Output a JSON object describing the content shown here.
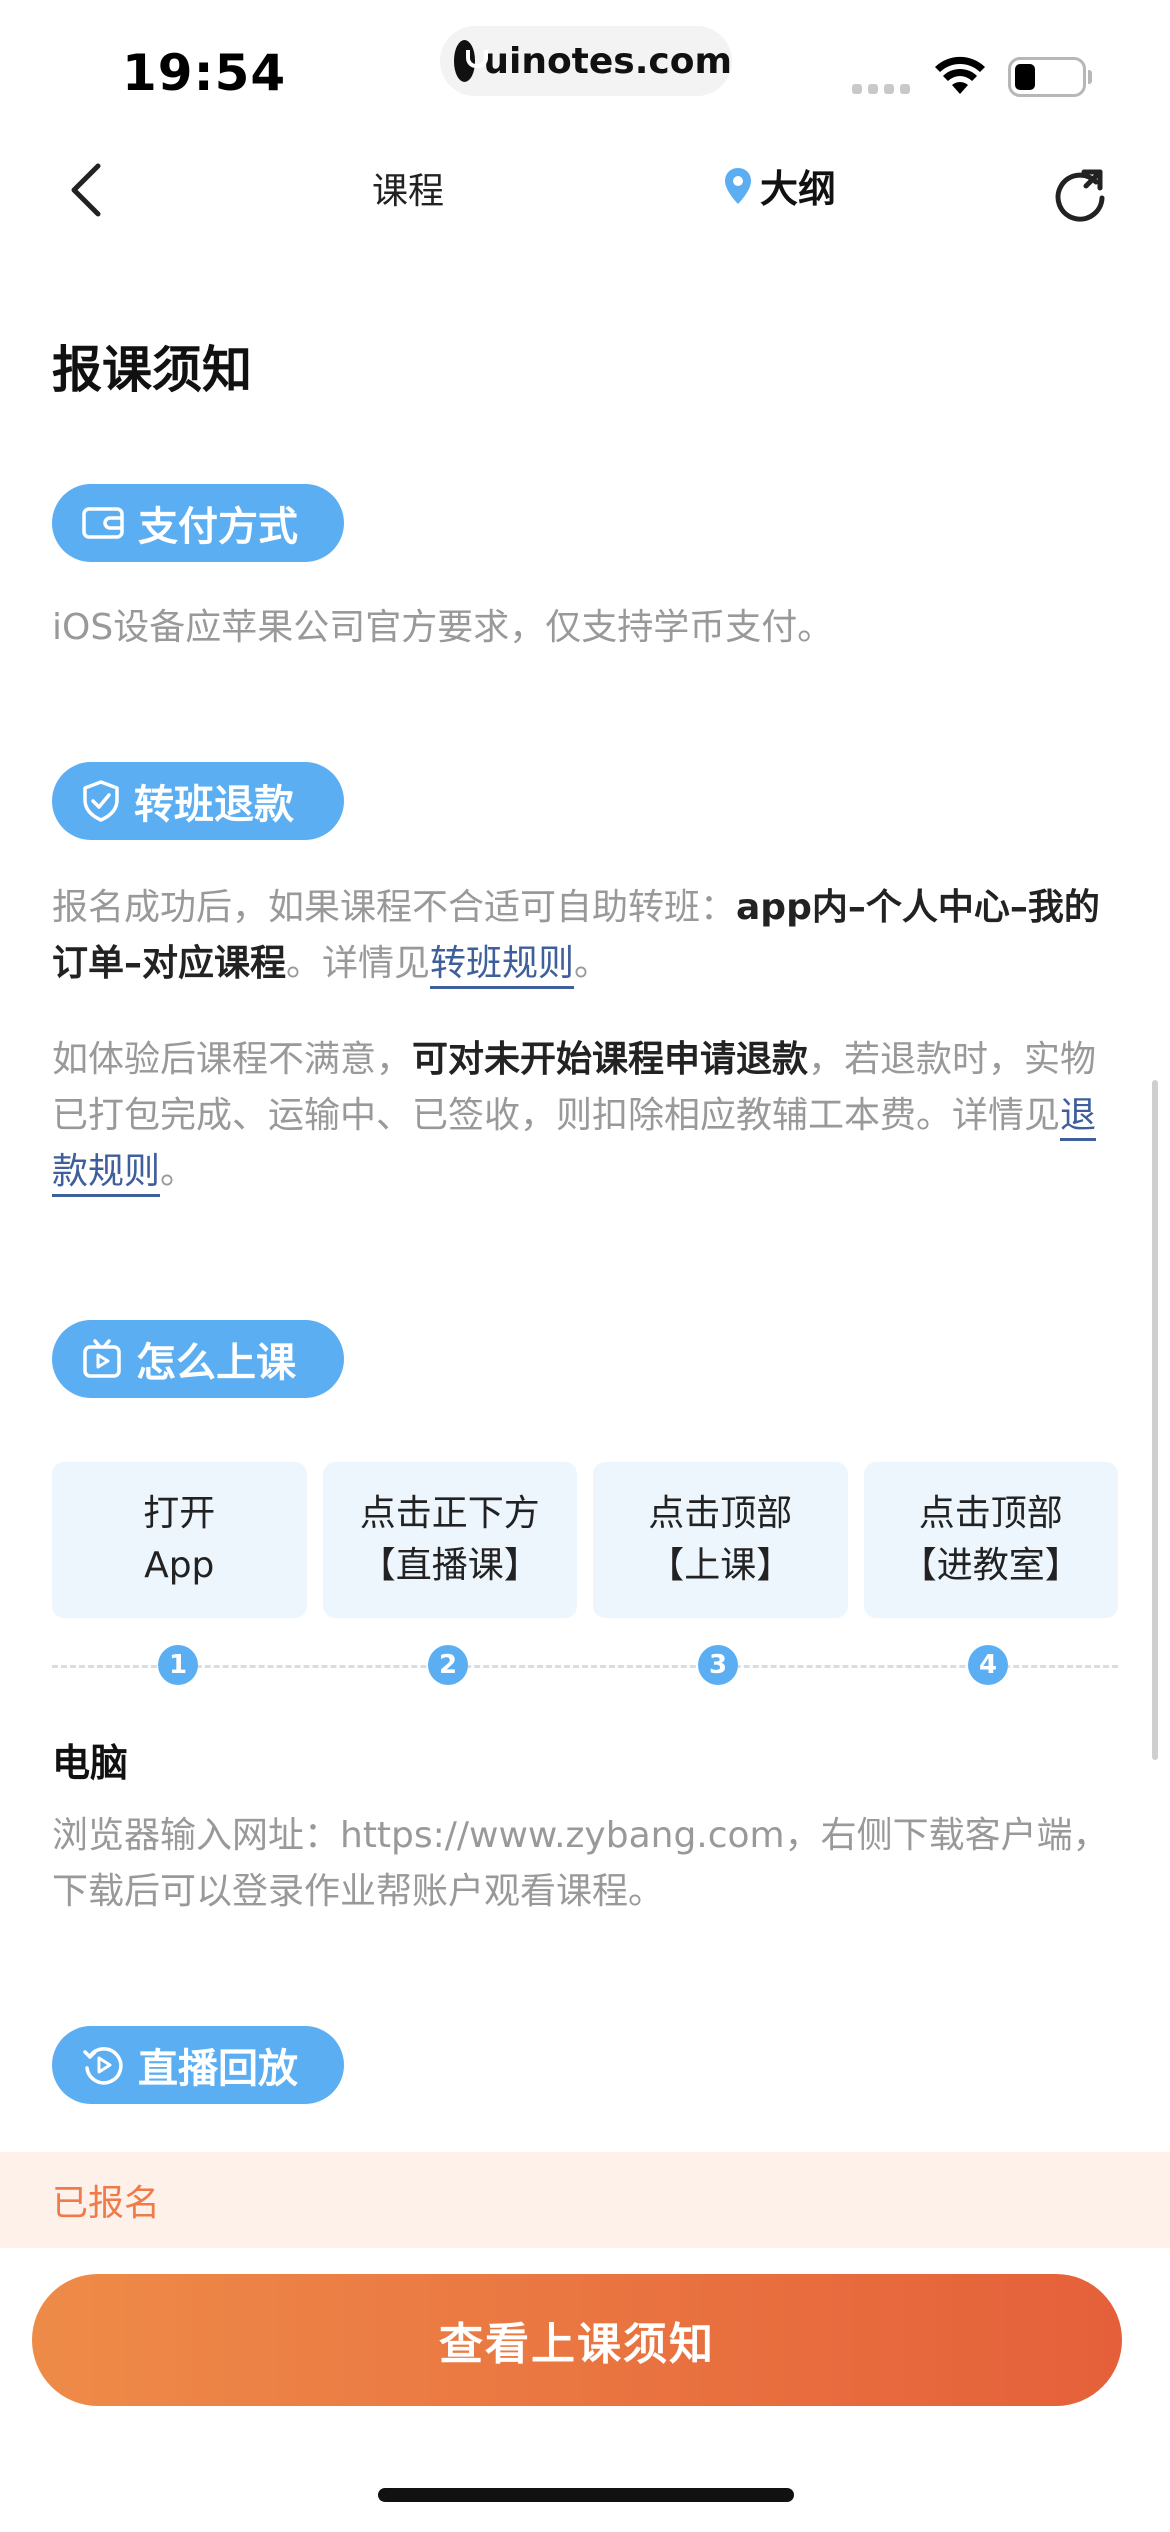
{
  "status_bar": {
    "time": "19:54",
    "url": "uinotes.com"
  },
  "nav": {
    "back_icon": "chevron-left-icon",
    "title": "课程",
    "outline_label": "大纲",
    "outline_icon": "location-pin-icon",
    "refresh_icon": "refresh-icon"
  },
  "page": {
    "heading": "报课须知",
    "payment": {
      "tag": "支付方式",
      "icon": "wallet-icon",
      "text": "iOS设备应苹果公司官方要求，仅支持学币支付。"
    },
    "transfer": {
      "tag": "转班退款",
      "icon": "shield-check-icon",
      "p1_a": "报名成功后，如果课程不合适可自助转班：",
      "p1_b": "app内–个人中心–我的订单–对应课程",
      "p1_c": "。详情见",
      "p1_link": "转班规则",
      "p1_end": "。",
      "p2_a": "如体验后课程不满意，",
      "p2_b": "可对未开始课程申请退款",
      "p2_c": "，若退款时，实物已打包完成、运输中、已签收，则扣除相应教辅工本费。详情见",
      "p2_link": "退款规则",
      "p2_end": "。"
    },
    "how": {
      "tag": "怎么上课",
      "icon": "tv-play-icon",
      "steps": [
        {
          "line1": "打开",
          "line2": "App",
          "num": "1"
        },
        {
          "line1": "点击正下方",
          "line2": "【直播课】",
          "num": "2"
        },
        {
          "line1": "点击顶部",
          "line2": "【上课】",
          "num": "3"
        },
        {
          "line1": "点击顶部",
          "line2": "【进教室】",
          "num": "4"
        }
      ],
      "pc_title": "电脑",
      "pc_text": "浏览器输入网址：https://www.zybang.com，右侧下载客户端，下载后可以登录作业帮账户观看课程。"
    },
    "replay": {
      "tag": "直播回放",
      "icon": "replay-icon"
    }
  },
  "bottom": {
    "enrolled": "已报名",
    "cta": "查看上课须知"
  },
  "colors": {
    "accent_blue": "#5caef2",
    "cta_orange": "#e96d3e",
    "link_blue": "#3f5f9c"
  }
}
